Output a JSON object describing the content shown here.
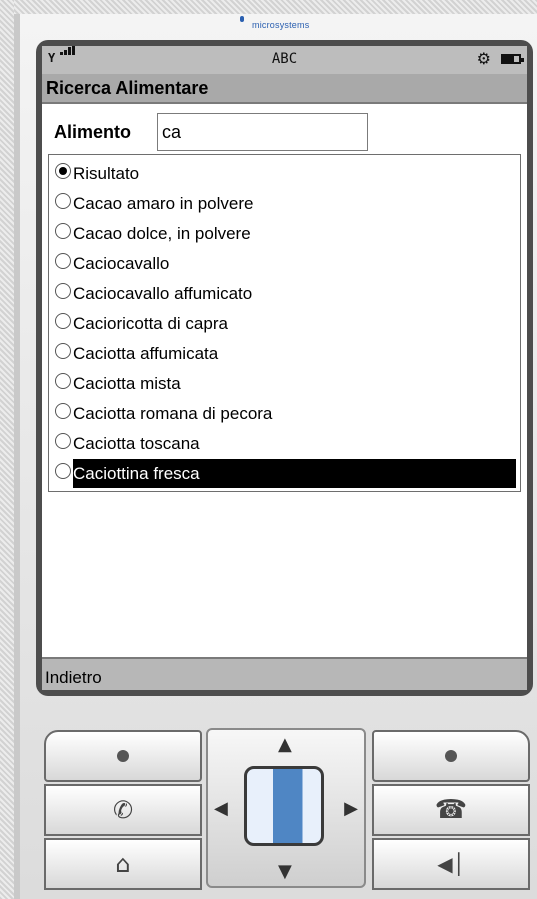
{
  "header": {
    "brand": "microsystems"
  },
  "status": {
    "signal_glyph": "Y",
    "mode": "ABC",
    "gear_glyph": "⚙"
  },
  "screen": {
    "title": "Ricerca Alimentare",
    "search": {
      "label": "Alimento",
      "value": "ca"
    },
    "results": [
      {
        "label": "Risultato",
        "checked": true
      },
      {
        "label": "Cacao amaro in polvere",
        "checked": false
      },
      {
        "label": "Cacao dolce, in polvere",
        "checked": false
      },
      {
        "label": "Caciocavallo",
        "checked": false
      },
      {
        "label": "Caciocavallo affumicato",
        "checked": false
      },
      {
        "label": "Cacioricotta di capra",
        "checked": false
      },
      {
        "label": "Caciotta affumicata",
        "checked": false
      },
      {
        "label": "Caciotta mista",
        "checked": false
      },
      {
        "label": "Caciotta romana di pecora",
        "checked": false
      },
      {
        "label": "Caciotta toscana",
        "checked": false
      },
      {
        "label": "Caciottina fresca",
        "checked": false,
        "selected": true
      }
    ],
    "softkey_left": "Indietro"
  },
  "keypad": {
    "icons": [
      "soft-left-dot-icon",
      "call-icon",
      "home-icon",
      "soft-right-dot-icon",
      "end-call-icon",
      "back-icon"
    ]
  }
}
